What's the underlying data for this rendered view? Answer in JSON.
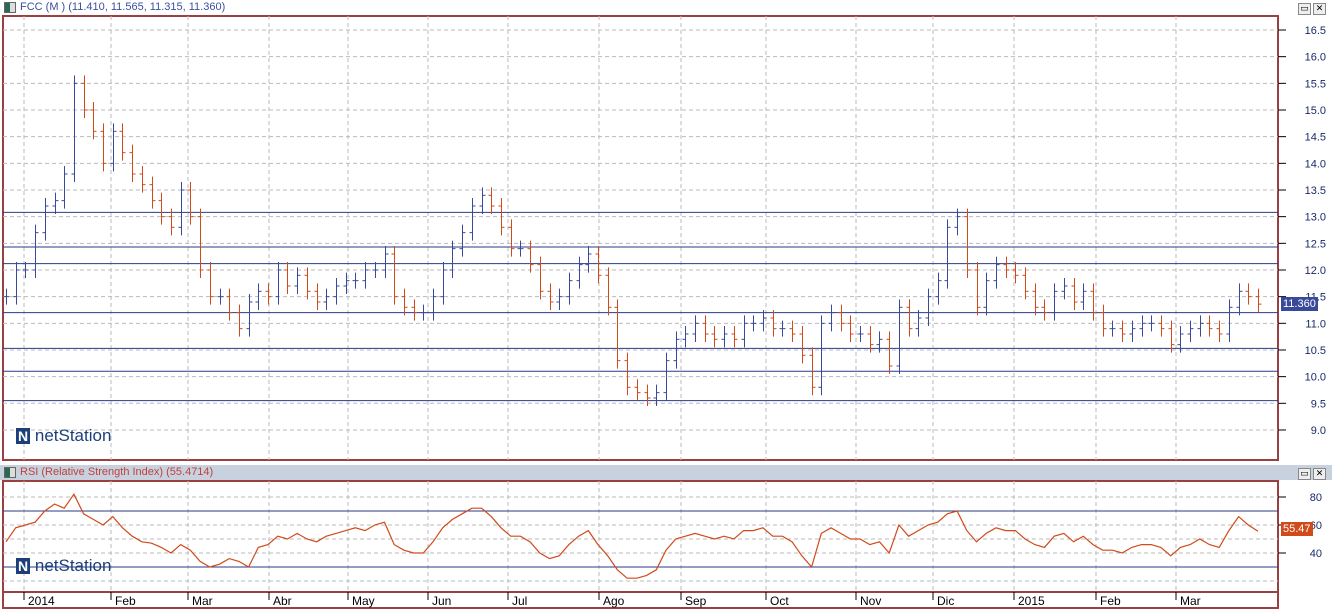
{
  "main_panel": {
    "title": "FCC (M ) (11.410, 11.565, 11.315, 11.360)",
    "last_price": "11.360",
    "logo": "netStation"
  },
  "rsi_panel": {
    "title": "RSI (Relative Strength Index) (55.4714)",
    "last_value": "55.47",
    "logo": "netStation"
  },
  "window_buttons": {
    "maximize": "▭",
    "close": "✕"
  },
  "colors": {
    "up": "#3a4a9a",
    "down": "#d04a1a",
    "rsi_line": "#d04a1a",
    "frame": "#9a4040",
    "hline": "#2a3a8a"
  },
  "chart_data": [
    {
      "type": "ohlc",
      "title": "FCC (M )",
      "ylim": [
        8.8,
        16.7
      ],
      "yticks": [
        "16.5",
        "16.0",
        "15.5",
        "15.0",
        "14.5",
        "14.0",
        "13.5",
        "13.0",
        "12.5",
        "12.0",
        "11.5",
        "11.0",
        "10.5",
        "10.0",
        "9.5",
        "9.0"
      ],
      "x_labels": [
        "2014",
        "Feb",
        "Mar",
        "Abr",
        "May",
        "Jun",
        "Jul",
        "Ago",
        "Sep",
        "Oct",
        "Nov",
        "Dic",
        "2015",
        "Feb",
        "Mar"
      ],
      "horizontal_lines": [
        13.08,
        12.43,
        12.12,
        11.2,
        10.53,
        10.1,
        9.55
      ],
      "closes": [
        11.5,
        12.0,
        12.0,
        12.7,
        13.2,
        13.3,
        13.8,
        15.5,
        15.0,
        14.6,
        14.0,
        14.6,
        14.2,
        13.8,
        13.6,
        13.3,
        13.0,
        12.8,
        13.5,
        13.0,
        12.0,
        11.5,
        11.5,
        11.2,
        10.9,
        11.4,
        11.6,
        11.5,
        12.0,
        11.7,
        11.9,
        11.6,
        11.4,
        11.5,
        11.7,
        11.8,
        11.8,
        12.0,
        12.0,
        12.3,
        11.5,
        11.3,
        11.2,
        11.2,
        11.5,
        12.0,
        12.4,
        12.7,
        13.2,
        13.4,
        13.2,
        12.8,
        12.4,
        12.4,
        12.1,
        11.6,
        11.4,
        11.5,
        11.8,
        12.1,
        12.3,
        11.9,
        11.3,
        10.3,
        9.8,
        9.7,
        9.6,
        9.7,
        10.3,
        10.7,
        10.8,
        11.0,
        10.8,
        10.7,
        10.8,
        10.7,
        11.0,
        11.0,
        11.1,
        10.9,
        10.9,
        10.8,
        10.4,
        9.8,
        11.0,
        11.2,
        11.0,
        10.8,
        10.8,
        10.6,
        10.7,
        10.2,
        11.3,
        10.9,
        11.1,
        11.5,
        11.8,
        12.8,
        13.0,
        12.0,
        11.3,
        11.8,
        12.1,
        12.0,
        11.9,
        11.6,
        11.3,
        11.2,
        11.6,
        11.7,
        11.4,
        11.6,
        11.2,
        10.9,
        10.9,
        10.8,
        10.9,
        11.0,
        11.0,
        10.9,
        10.6,
        10.8,
        10.9,
        11.0,
        10.9,
        10.8,
        11.3,
        11.6,
        11.5,
        11.36
      ]
    },
    {
      "type": "line",
      "title": "RSI (Relative Strength Index)",
      "ylim": [
        20,
        90
      ],
      "yticks": [
        "80",
        "60",
        "40"
      ],
      "horizontal_lines": [
        70,
        30
      ],
      "values": [
        48,
        58,
        60,
        62,
        70,
        75,
        72,
        82,
        68,
        64,
        60,
        66,
        58,
        52,
        48,
        47,
        44,
        40,
        46,
        42,
        34,
        30,
        32,
        36,
        34,
        30,
        44,
        46,
        52,
        50,
        54,
        50,
        48,
        52,
        54,
        56,
        58,
        56,
        60,
        62,
        46,
        42,
        40,
        40,
        48,
        58,
        64,
        68,
        72,
        72,
        66,
        58,
        52,
        52,
        48,
        40,
        36,
        38,
        46,
        52,
        56,
        46,
        38,
        28,
        22,
        22,
        24,
        28,
        42,
        50,
        52,
        54,
        52,
        50,
        52,
        50,
        56,
        56,
        58,
        52,
        52,
        48,
        38,
        30,
        54,
        58,
        54,
        50,
        50,
        46,
        48,
        40,
        60,
        52,
        56,
        60,
        62,
        68,
        70,
        56,
        48,
        54,
        58,
        56,
        56,
        50,
        46,
        44,
        52,
        54,
        48,
        52,
        46,
        42,
        42,
        40,
        44,
        46,
        46,
        44,
        38,
        44,
        46,
        50,
        46,
        44,
        56,
        66,
        60,
        55.47
      ]
    }
  ]
}
